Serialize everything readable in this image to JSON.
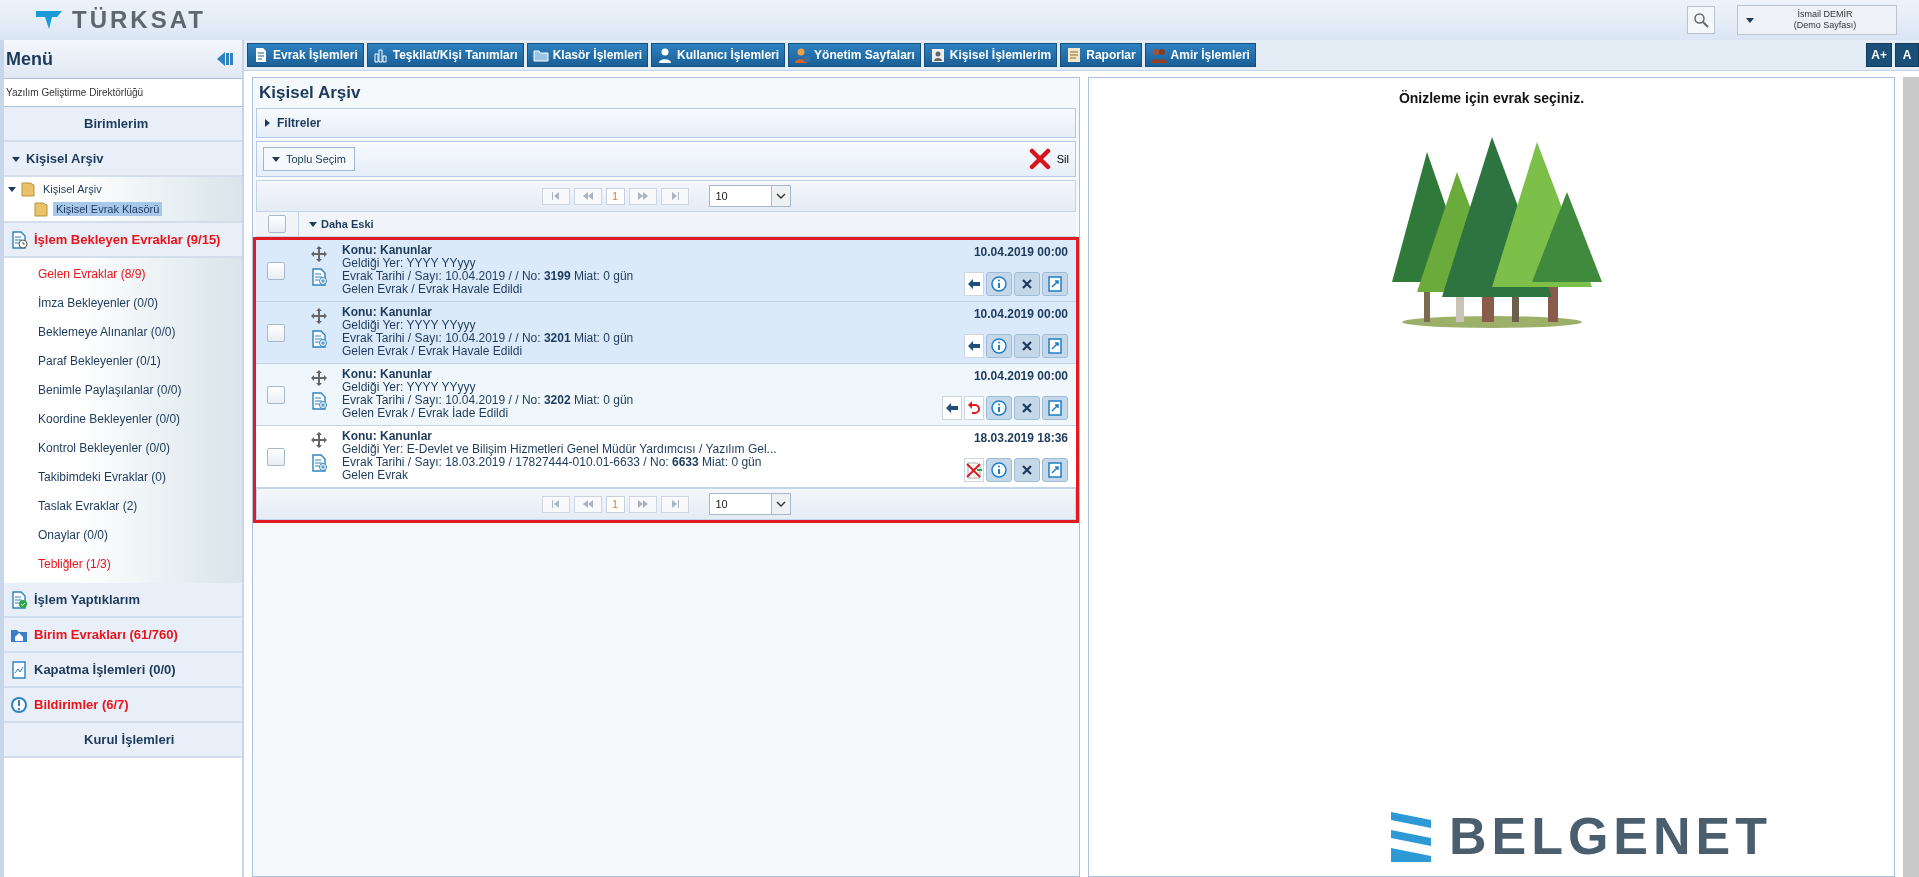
{
  "header": {
    "brand": "TÜRKSAT",
    "user": {
      "name": "İsmail DEMİR",
      "page": "(Demo Sayfası)"
    }
  },
  "menu_bar": {
    "items": [
      {
        "label": "Evrak İşlemleri"
      },
      {
        "label": "Teşkilat/Kişi Tanımları"
      },
      {
        "label": "Klasör İşlemleri"
      },
      {
        "label": "Kullanıcı İşlemleri"
      },
      {
        "label": "Yönetim Sayfaları"
      },
      {
        "label": "Kişisel İşlemlerim"
      },
      {
        "label": "Raporlar"
      },
      {
        "label": "Amir İşlemleri"
      }
    ],
    "font_buttons": [
      "A+",
      "A"
    ]
  },
  "sidebar": {
    "title": "Menü",
    "org": "Yazılım Geliştirme Direktörlüğü",
    "sections": [
      {
        "kind": "plain",
        "label": "Birimlerim",
        "alert": false
      },
      {
        "kind": "tree",
        "label": "Kişisel Arşiv",
        "expanded": true,
        "alert": false,
        "children": [
          {
            "label": "Kişisel Arşiv",
            "expanded": true,
            "selected": false,
            "children": [
              {
                "label": "Kişisel Evrak Klasörü",
                "selected": true
              }
            ]
          }
        ]
      },
      {
        "kind": "icon",
        "label": "İşlem Bekleyen Evraklar (9/15)",
        "alert": true,
        "items": [
          {
            "label": "Gelen Evraklar (8/9)",
            "alert": true
          },
          {
            "label": "İmza Bekleyenler (0/0)",
            "alert": false
          },
          {
            "label": "Beklemeye Alınanlar (0/0)",
            "alert": false
          },
          {
            "label": "Paraf Bekleyenler (0/1)",
            "alert": false
          },
          {
            "label": "Benimle Paylaşılanlar (0/0)",
            "alert": false
          },
          {
            "label": "Koordine Bekleyenler (0/0)",
            "alert": false
          },
          {
            "label": "Kontrol Bekleyenler (0/0)",
            "alert": false
          },
          {
            "label": "Takibimdeki Evraklar (0)",
            "alert": false
          },
          {
            "label": "Taslak Evraklar (2)",
            "alert": false
          },
          {
            "label": "Onaylar (0/0)",
            "alert": false
          },
          {
            "label": "Tebliğler (1/3)",
            "alert": true
          }
        ]
      },
      {
        "kind": "icon",
        "label": "İşlem Yaptıklarım",
        "alert": false
      },
      {
        "kind": "icon",
        "label": "Birim Evrakları (61/760)",
        "alert": true
      },
      {
        "kind": "icon",
        "label": "Kapatma İşlemleri (0/0)",
        "alert": false
      },
      {
        "kind": "icon",
        "label": "Bildirimler (6/7)",
        "alert": true
      },
      {
        "kind": "plain",
        "label": "Kurul İşlemleri",
        "alert": false
      }
    ]
  },
  "archive": {
    "title": "Kişisel Arşiv",
    "filters": {
      "label": "Filtreler",
      "expanded": false
    },
    "bulk_select": "Toplu Seçim",
    "delete": "Sil",
    "pager_top": {
      "page": "1",
      "page_size": "10"
    },
    "group": {
      "label": "Daha Eski",
      "expanded": true,
      "checked": false
    },
    "rows": [
      {
        "subject": "Konu: Kanunlar",
        "origin": "Geldiği Yer: YYYY YYyyy",
        "meta": "Evrak Tarihi / Sayı: 10.04.2019 / / No: **3199** Miat: 0 gün",
        "status": "Gelen Evrak / Evrak Havale Edildi",
        "date": "10.04.2019 00:00",
        "checked": false,
        "selected": true,
        "hovered": false,
        "actions": [
          {
            "kind": "forward"
          },
          {
            "kind": "info"
          },
          {
            "kind": "close"
          },
          {
            "kind": "open"
          }
        ]
      },
      {
        "subject": "Konu: Kanunlar",
        "origin": "Geldiği Yer: YYYY YYyyy",
        "meta": "Evrak Tarihi / Sayı: 10.04.2019 / / No: **3201** Miat: 0 gün",
        "status": "Gelen Evrak / Evrak Havale Edildi",
        "date": "10.04.2019 00:00",
        "checked": false,
        "selected": true,
        "hovered": false,
        "actions": [
          {
            "kind": "forward"
          },
          {
            "kind": "info"
          },
          {
            "kind": "close"
          },
          {
            "kind": "open"
          }
        ]
      },
      {
        "subject": "Konu: Kanunlar",
        "origin": "Geldiği Yer: YYYY YYyyy",
        "meta": "Evrak Tarihi / Sayı: 10.04.2019 / / No: **3202** Miat: 0 gün",
        "status": "Gelen Evrak / Evrak İade Edildi",
        "date": "10.04.2019 00:00",
        "checked": false,
        "selected": false,
        "hovered": true,
        "actions": [
          {
            "kind": "forward"
          },
          {
            "kind": "return"
          },
          {
            "kind": "info"
          },
          {
            "kind": "close"
          },
          {
            "kind": "open"
          }
        ]
      },
      {
        "subject": "Konu: Kanunlar",
        "origin": "Geldiği Yer: E-Devlet ve Bilişim Hizmetleri Genel Müdür Yardımcısı / Yazılım Gel...",
        "meta": "Evrak Tarihi / Sayı: 18.03.2019 / 17827444-010.01-6633 / No: **6633** Miat: 0 gün",
        "status": "Gelen Evrak",
        "date": "18.03.2019 18:36",
        "checked": false,
        "selected": false,
        "hovered": false,
        "actions": [
          {
            "kind": "cancel"
          },
          {
            "kind": "info"
          },
          {
            "kind": "close"
          },
          {
            "kind": "open"
          }
        ]
      }
    ],
    "pager_bottom": {
      "page": "1",
      "page_size": "10"
    }
  },
  "preview": {
    "message": "Önizleme için evrak seçiniz.",
    "logo": "BELGENET"
  }
}
